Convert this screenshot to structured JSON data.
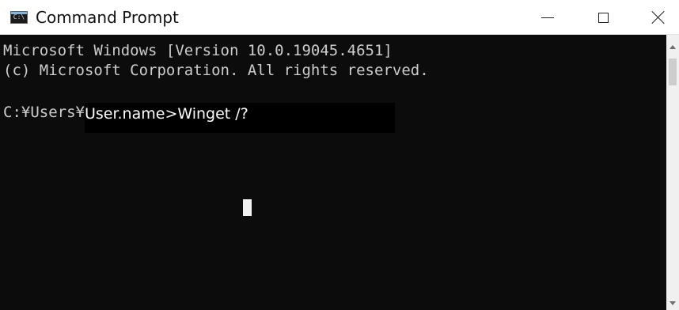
{
  "window": {
    "title": "Command Prompt",
    "icon": "cmd-icon"
  },
  "title_buttons": {
    "minimize": "minimize-icon",
    "maximize": "maximize-icon",
    "close": "close-icon"
  },
  "console": {
    "lines": [
      "Microsoft Windows [Version 10.0.19045.4651]",
      "(c) Microsoft Corporation. All rights reserved."
    ],
    "prompt_path": "C:¥Users¥",
    "selected_text": "User.name>Winget /?",
    "background": "#0c0c0c",
    "foreground": "#cccccc"
  }
}
